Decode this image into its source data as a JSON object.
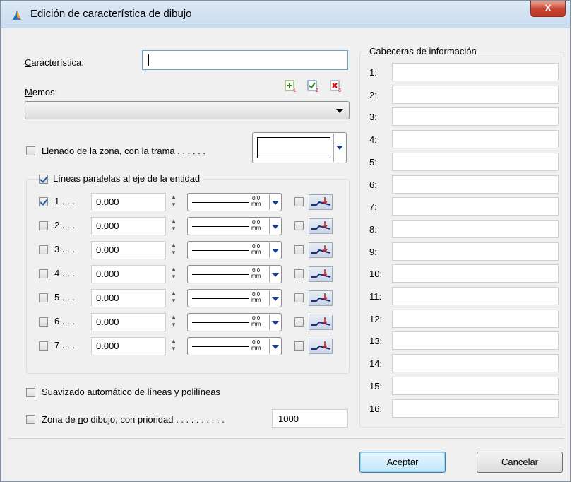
{
  "window": {
    "title": "Edición de característica de dibujo",
    "close_glyph": "X"
  },
  "caracteristica": {
    "label": "Característica:",
    "value": ""
  },
  "memos": {
    "label": "Memos:",
    "value": "",
    "toolbar_icons": [
      "memo-add-icon",
      "memo-check-icon",
      "memo-delete-icon"
    ]
  },
  "llenado": {
    "label": "Llenado de la zona, con la trama . . . . . .",
    "checked": false
  },
  "lineas": {
    "label": "Líneas paralelas al eje de la entidad",
    "checked": true,
    "rows": [
      {
        "label": "1 . . .",
        "value": "0.000",
        "checked": true,
        "width_top": "0.0",
        "width_unit": "mm"
      },
      {
        "label": "2 . . .",
        "value": "0.000",
        "checked": false,
        "width_top": "0.0",
        "width_unit": "mm"
      },
      {
        "label": "3 . . .",
        "value": "0.000",
        "checked": false,
        "width_top": "0.0",
        "width_unit": "mm"
      },
      {
        "label": "4 . . .",
        "value": "0.000",
        "checked": false,
        "width_top": "0.0",
        "width_unit": "mm"
      },
      {
        "label": "5 . . .",
        "value": "0.000",
        "checked": false,
        "width_top": "0.0",
        "width_unit": "mm"
      },
      {
        "label": "6 . . .",
        "value": "0.000",
        "checked": false,
        "width_top": "0.0",
        "width_unit": "mm"
      },
      {
        "label": "7 . . .",
        "value": "0.000",
        "checked": false,
        "width_top": "0.0",
        "width_unit": "mm"
      }
    ]
  },
  "suavizado": {
    "label": "Suavizado automático de líneas y polilíneas",
    "checked": false
  },
  "zona": {
    "label_pre": "Zona de ",
    "label_u": "n",
    "label_post": "o dibujo, con prioridad . . . . . . . . . .",
    "value": "1000",
    "checked": false
  },
  "cabeceras": {
    "title": "Cabeceras de información",
    "rows": [
      "1:",
      "2:",
      "3:",
      "4:",
      "5:",
      "6:",
      "7:",
      "8:",
      "9:",
      "10:",
      "11:",
      "12:",
      "13:",
      "14:",
      "15:",
      "16:"
    ]
  },
  "buttons": {
    "accept": "Aceptar",
    "cancel": "Cancelar"
  },
  "colors": {
    "accent": "#3c7fb1",
    "checkmark": "#2a57b3",
    "close": "#c9452f"
  }
}
